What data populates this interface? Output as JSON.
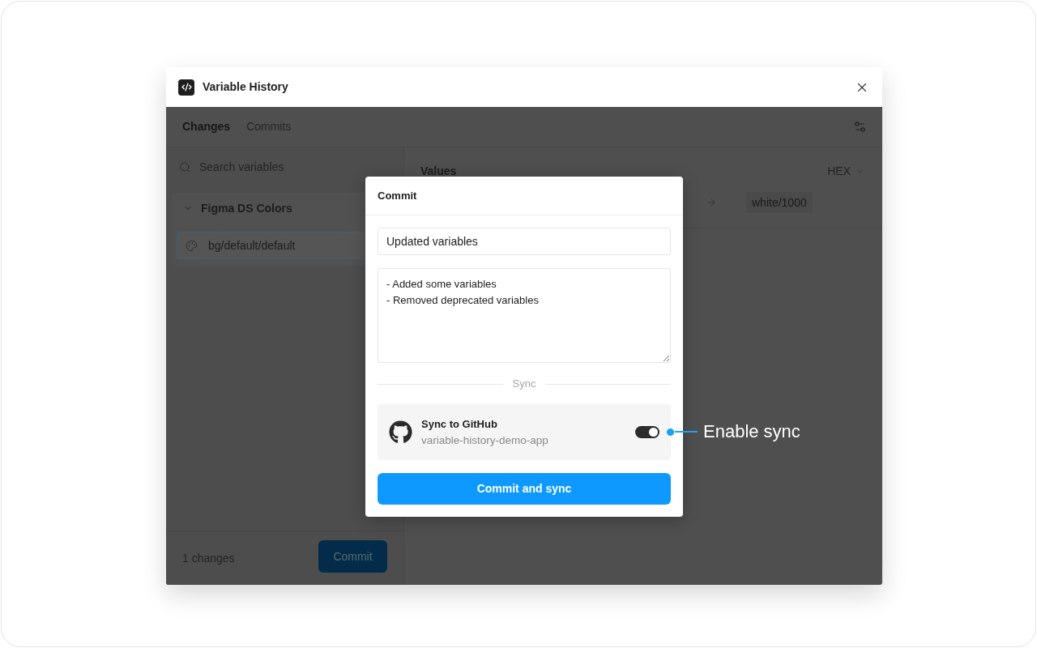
{
  "window": {
    "title": "Variable History"
  },
  "tabs": [
    {
      "label": "Changes",
      "selected": true
    },
    {
      "label": "Commits",
      "selected": false
    }
  ],
  "search": {
    "placeholder": "Search variables"
  },
  "collection": {
    "name": "Figma DS Colors",
    "expanded": true,
    "items": [
      {
        "name": "bg/default/default",
        "selected": true
      }
    ]
  },
  "footer": {
    "count": "1 changes",
    "button": "Commit"
  },
  "values_panel": {
    "heading": "Values",
    "format": "HEX",
    "rows": [
      {
        "new_value": "white/1000"
      }
    ]
  },
  "commit_dialog": {
    "title": "Commit",
    "summary": {
      "value": "Updated variables"
    },
    "description": {
      "value": "- Added some variables\n- Removed deprecated variables"
    },
    "divider_label": "Sync",
    "sync": {
      "title": "Sync to GitHub",
      "repository": "variable-history-demo-app",
      "on": true
    },
    "button": "Commit and sync"
  },
  "annotation": {
    "label": "Enable sync"
  }
}
